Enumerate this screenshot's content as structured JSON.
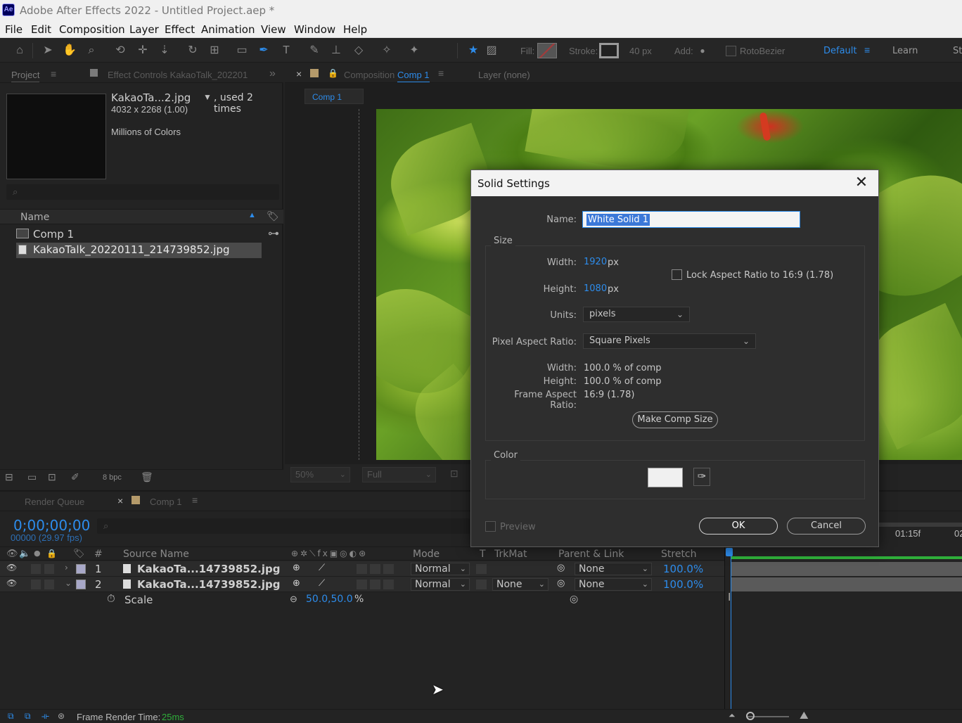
{
  "window": {
    "app_badge": "Ae",
    "title": "Adobe After Effects 2022 - Untitled Project.aep *"
  },
  "menu": [
    "File",
    "Edit",
    "Composition",
    "Layer",
    "Effect",
    "Animation",
    "View",
    "Window",
    "Help"
  ],
  "toolbar": {
    "fill_label": "Fill:",
    "stroke_label": "Stroke:",
    "stroke_width": "40 px",
    "add_label": "Add:",
    "rotobezier_label": "RotoBezier",
    "workspace_default": "Default",
    "workspace_learn": "Learn",
    "workspace_more": "St"
  },
  "project_panel": {
    "tab_project": "Project",
    "tab_effect_controls": "Effect Controls KakaoTalk_202201",
    "selected_name": "KakaoTa...2.jpg",
    "used_times": ", used 2 times",
    "dimensions": "4032 x 2268 (1.00)",
    "colors": "Millions of Colors",
    "column_name": "Name",
    "items": [
      {
        "name": "Comp 1",
        "type": "composition"
      },
      {
        "name": "KakaoTalk_20220111_214739852.jpg",
        "type": "footage"
      }
    ],
    "bpc": "8 bpc"
  },
  "comp_panel": {
    "tab_prefix": "Composition",
    "tab_comp": "Comp 1",
    "layer_tab": "Layer (none)",
    "breadcrumb": "Comp 1",
    "zoom": "50%",
    "resolution": "Full"
  },
  "timeline": {
    "tab_render_queue": "Render Queue",
    "tab_comp": "Comp 1",
    "timecode": "0;00;00;00",
    "frames": "00000 (29.97 fps)",
    "columns": {
      "hash": "#",
      "source_name": "Source Name",
      "mode": "Mode",
      "t": "T",
      "trkmat": "TrkMat",
      "parent": "Parent & Link",
      "stretch": "Stretch"
    },
    "layers": [
      {
        "index": "1",
        "name": "KakaoTa...14739852.jpg",
        "mode": "Normal",
        "trkmat": "",
        "parent": "None",
        "stretch": "100.0%"
      },
      {
        "index": "2",
        "name": "KakaoTa...14739852.jpg",
        "mode": "Normal",
        "trkmat": "None",
        "parent": "None",
        "stretch": "100.0%"
      }
    ],
    "scale_property": {
      "label": "Scale",
      "value_x": "50.0",
      "value_y": ",50.0",
      "unit": "%"
    },
    "ruler_label": "01:15f",
    "ruler_label_2": "02"
  },
  "status": {
    "render_time_label": "Frame Render Time:",
    "render_time_value": "25ms"
  },
  "dialog": {
    "title": "Solid Settings",
    "name_label": "Name:",
    "name_value": "White Solid 1",
    "size_group": "Size",
    "width_label": "Width:",
    "width_value": "1920",
    "height_label": "Height:",
    "height_value": "1080",
    "px": "px",
    "lock_aspect": "Lock Aspect Ratio to 16:9 (1.78)",
    "units_label": "Units:",
    "units_value": "pixels",
    "par_label": "Pixel Aspect Ratio:",
    "par_value": "Square Pixels",
    "width_pct_label": "Width:",
    "width_pct_value": "100.0 % of comp",
    "height_pct_label": "Height:",
    "height_pct_value": "100.0 % of comp",
    "far_label": "Frame Aspect Ratio:",
    "far_value": "16:9 (1.78)",
    "make_comp_size": "Make Comp Size",
    "color_group": "Color",
    "color_value": "#f0f0f0",
    "preview_label": "Preview",
    "ok": "OK",
    "cancel": "Cancel"
  }
}
